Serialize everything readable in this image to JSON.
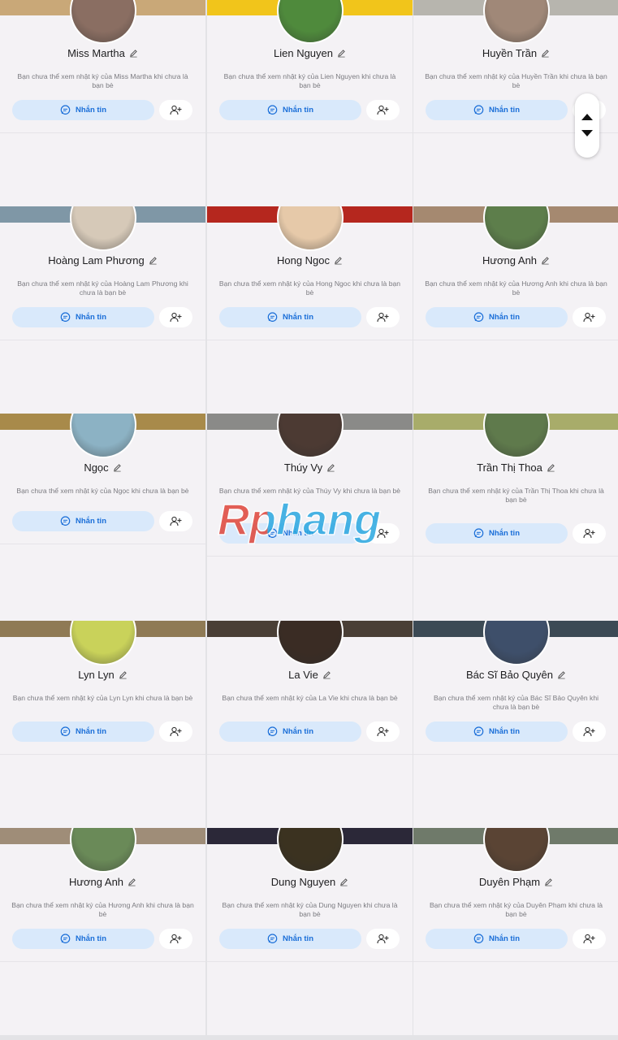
{
  "cards": [
    {
      "name": "Miss Martha",
      "desc": "Bạn chưa thể xem nhật ký của Miss Martha khi chưa là bạn bè",
      "message_label": "Nhắn tin",
      "cover": "#c9a878",
      "avatar": "#8a6e62"
    },
    {
      "name": "Lien Nguyen",
      "desc": "Bạn chưa thể xem nhật ký của Lien Nguyen khi chưa là bạn bè",
      "message_label": "Nhắn tin",
      "cover": "#f1c51b",
      "avatar": "#4f8a3c"
    },
    {
      "name": "Huyền Trần",
      "desc": "Bạn chưa thể xem nhật ký của Huyền Trần khi chưa là bạn bè",
      "message_label": "Nhắn tin",
      "cover": "#b7b5ae",
      "avatar": "#a08878"
    },
    {
      "name": "Hoàng Lam Phương",
      "desc": "Bạn chưa thể xem nhật ký của Hoàng Lam Phương khi chưa là bạn bè",
      "message_label": "Nhắn tin",
      "cover": "#7f97a6",
      "avatar": "#d6c9b8"
    },
    {
      "name": "Hong Ngoc",
      "desc": "Bạn chưa thể xem nhật ký của Hong Ngoc khi chưa là bạn bè",
      "message_label": "Nhắn tin",
      "cover": "#b5271e",
      "avatar": "#e6c9a9"
    },
    {
      "name": "Hương Anh",
      "desc": "Bạn chưa thể xem nhật ký của Hương Anh khi chưa là bạn bè",
      "message_label": "Nhắn tin",
      "cover": "#a58970",
      "avatar": "#5d7e4b"
    },
    {
      "name": "Ngọc",
      "desc": "Bạn chưa thể xem nhật ký của Ngọc khi chưa là bạn bè",
      "message_label": "Nhắn tin",
      "cover": "#a88a4a",
      "avatar": "#8cb2c4"
    },
    {
      "name": "Thúy Vy",
      "desc": "Bạn chưa thể xem nhật ký của Thúy Vy khi chưa là bạn bè",
      "message_label": "Nhắn tin",
      "cover": "#8a8a88",
      "avatar": "#4c3a33"
    },
    {
      "name": "Trần Thị Thoa",
      "desc": "Bạn chưa thể xem nhật ký của Trần Thị Thoa khi chưa là bạn bè",
      "message_label": "Nhắn tin",
      "cover": "#a8ac6a",
      "avatar": "#5f7a4c"
    },
    {
      "name": "Lyn Lyn",
      "desc": "Bạn chưa thể xem nhật ký của Lyn Lyn khi chưa là bạn bè",
      "message_label": "Nhắn tin",
      "cover": "#8f7a55",
      "avatar": "#c9d25a"
    },
    {
      "name": "La Vie",
      "desc": "Bạn chưa thể xem nhật ký của La Vie khi chưa là bạn bè",
      "message_label": "Nhắn tin",
      "cover": "#4a3f36",
      "avatar": "#3a2c24"
    },
    {
      "name": "Bác Sĩ Bảo Quyên",
      "desc": "Bạn chưa thể xem nhật ký của Bác Sĩ Bảo Quyên khi chưa là bạn bè",
      "message_label": "Nhắn tin",
      "cover": "#3c4a55",
      "avatar": "#3e4f6a"
    },
    {
      "name": "Hương Anh",
      "desc": "Bạn chưa thể xem nhật ký của Hương Anh khi chưa là bạn bè",
      "message_label": "Nhắn tin",
      "cover": "#9f8d78",
      "avatar": "#6a8a58"
    },
    {
      "name": "Dung Nguyen",
      "desc": "Bạn chưa thể xem nhật ký của Dung Nguyen khi chưa là bạn bè",
      "message_label": "Nhắn tin",
      "cover": "#2b2838",
      "avatar": "#3b3220"
    },
    {
      "name": "Duyên Phạm",
      "desc": "Bạn chưa thể xem nhật ký của Duyên Phạm khi chưa là bạn bè",
      "message_label": "Nhắn tin",
      "cover": "#6f7a6a",
      "avatar": "#5a4434"
    }
  ],
  "watermark": "Rphang",
  "colors": {
    "accent": "#1a6ed8",
    "button_bg": "#d9e9fb",
    "card_bg": "#f4f2f5",
    "grid_gap": "#e3e3e6"
  }
}
